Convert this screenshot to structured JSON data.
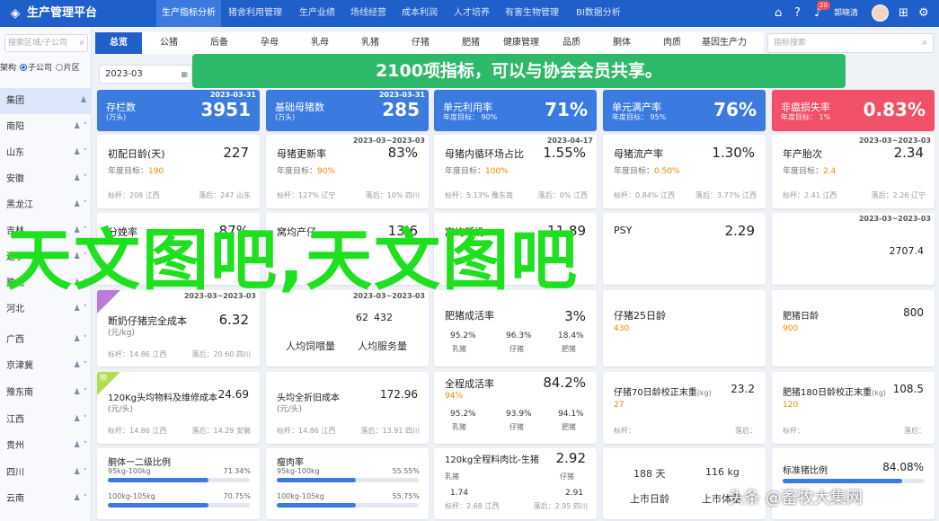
{
  "topbar": {
    "logo": "◈",
    "app_name": "生产管理平台",
    "nav": [
      "生产指标分析",
      "猪舍利用管理",
      "生产业绩",
      "场线经营",
      "成本利润",
      "人才培养",
      "有害生物管理",
      "BI数据分析"
    ],
    "active_index": 0,
    "notif_count": "20",
    "user": "郭晓清",
    "icons": [
      "home-icon",
      "help-icon",
      "bell-icon",
      "user-icon",
      "fullscreen-icon",
      "settings-icon"
    ]
  },
  "sidebar": {
    "search_placeholder": "搜索区域/子公司",
    "radio_label": "架构",
    "radio_opt1": "子公司",
    "radio_opt2": "片区",
    "items": [
      "集团",
      "南阳",
      "山东",
      "安徽",
      "黑龙江",
      "吉林",
      "辽宁",
      "豫北",
      "河北",
      "广西",
      "京津冀",
      "豫东南",
      "江西",
      "贵州",
      "四川",
      "云南"
    ]
  },
  "tabs": [
    "总览",
    "公猪",
    "后备",
    "孕母",
    "乳母",
    "乳猪",
    "仔猪",
    "肥猪",
    "健康管理",
    "品质",
    "胴体",
    "肉质",
    "基因生产力"
  ],
  "right_search_placeholder": "指标搜索",
  "date": "2023-03",
  "banner": "2100项指标，可以与协会会员共享。",
  "kpis": [
    {
      "title": "存栏数",
      "sub": "(万头)",
      "value": "3951",
      "date": "2023-03-31",
      "color": "#3b7be0"
    },
    {
      "title": "基础母猪数",
      "sub": "(万头)",
      "value": "285",
      "date": "2023-03-31",
      "color": "#3b7be0"
    },
    {
      "title": "单元利用率",
      "sub": "年度目标： 90%",
      "value": "71%",
      "date": "",
      "color": "#3b7be0"
    },
    {
      "title": "单元满产率",
      "sub": "年度目标： 95%",
      "value": "76%",
      "date": "",
      "color": "#3b7be0"
    },
    {
      "title": "非瘟损失率",
      "sub": "年度目标： 1%",
      "value": "0.83%",
      "date": "",
      "color": "#f05068"
    }
  ],
  "row1": [
    {
      "title": "初配日龄(天)",
      "value": "227",
      "date": "",
      "target_label": "年度目标：",
      "target": "190",
      "foot1": "标杆：208 江西",
      "foot2": "落后：247 山东"
    },
    {
      "title": "母猪更新率",
      "value": "83%",
      "date": "2023-03~2023-03",
      "target_label": "年度目标：",
      "target": "90%",
      "foot1": "标杆：127% 辽宁",
      "foot2": "落后：10% 四川"
    },
    {
      "title": "母猪内循环场占比",
      "value": "1.55%",
      "date": "2023-04-17",
      "target_label": "年度目标：",
      "target": "100%",
      "foot1": "标杆：5.13% 豫东南",
      "foot2": "落后：0% 江西"
    },
    {
      "title": "母猪流产率",
      "value": "1.30%",
      "date": "",
      "target_label": "年度目标：",
      "target": "0.50%",
      "foot1": "标杆：0.84% 江西",
      "foot2": "落后：3.77% 江西"
    },
    {
      "title": "年产胎次",
      "value": "2.34",
      "date": "2023-03~2023-03",
      "target_label": "年度目标：",
      "target": "2.4",
      "foot1": "标杆：2.41 江西",
      "foot2": "落后：2.26 辽宁"
    }
  ],
  "row2": [
    {
      "title": "分娩率",
      "value": "87%",
      "date": ""
    },
    {
      "title": "窝均产仔",
      "value": "13.6",
      "date": ""
    },
    {
      "title": "窝均断奶",
      "value": "11.89",
      "date": ""
    },
    {
      "title": "PSY",
      "value": "2.29",
      "date": "2023-03~2023-03"
    },
    {
      "title": "",
      "value": "2707.4",
      "date": ""
    }
  ],
  "row3": {
    "c1_title": "断奶仔猪完全成本",
    "c1_sub": "(元/kg)",
    "c1_value": "6.32",
    "c1_date": "2023-03~2023-03",
    "c1_foot1": "标杆：14.86 江西",
    "c1_foot2": "落后：20.60 四川",
    "c2_date": "2023-03~2023-03",
    "c2_l1": "人均饲喂量",
    "c2_l2": "人均服务量",
    "c2_v1": "62",
    "c2_v2": "432",
    "c3_title": "肥猪成活率",
    "c3_value": "3%",
    "c3_a": "95.2%",
    "c3_b": "96.3%",
    "c3_c": "18.4%",
    "c3_la": "乳猪",
    "c3_lb": "仔猪",
    "c3_lc": "肥猪",
    "c4_title": "仔猪25日龄",
    "c4_target": "430",
    "c4_value": "",
    "c5_title": "肥猪日龄",
    "c5_target": "900",
    "c5_value": "800"
  },
  "row4": {
    "c1_tag": "物",
    "c1_title": "120Kg头均物料及维修成本",
    "c1_sub": "(元/头)",
    "c1_value": "24.69",
    "c1_foot1": "标杆：14.86 江西",
    "c1_foot2": "落后：14.29 安徽",
    "c2_title": "头均全折旧成本",
    "c2_sub": "(元/头)",
    "c2_value": "172.96",
    "c2_foot1": "标杆：14.86 江西",
    "c2_foot2": "落后：13.91 四川",
    "c3_title": "全程成活率",
    "c3_value": "84.2%",
    "c3_target": "94%",
    "c3_a": "95.2%",
    "c3_b": "93.9%",
    "c3_c": "94.1%",
    "c3_la": "乳猪",
    "c3_lb": "仔猪",
    "c3_lc": "肥猪",
    "c4_title": "仔猪70日龄校正末重",
    "c4_sub": "(kg)",
    "c4_value": "23.2",
    "c4_target": "27",
    "c4_foot1": "标杆：",
    "c4_foot2": "落后：",
    "c5_title": "肥猪180日龄校正末重",
    "c5_sub": "(kg)",
    "c5_value": "108.5",
    "c5_target": "120",
    "c5_foot1": "标杆：",
    "c5_foot2": "落后："
  },
  "row5": {
    "c1_title": "胴体一二级比例",
    "c1_l1": "95kg-100kg",
    "c1_v1": "71.34%",
    "c1_l2": "100kg-105kg",
    "c1_v2": "70.75%",
    "c1_p1": 0.71,
    "c1_p2": 0.71,
    "c2_title": "瘦肉率",
    "c2_l1": "95kg-100kg",
    "c2_v1": "55.55%",
    "c2_l2": "100kg-105kg",
    "c2_v2": "55.75%",
    "c2_p1": 0.56,
    "c2_p2": 0.56,
    "c3_title": "120kg全程料肉比-生猪",
    "c3_value": "2.92",
    "c3_l1": "乳猪",
    "c3_l2": "仔猪",
    "c3_a": "1.74",
    "c3_b": "2.91",
    "c3_foot1": "标杆：2.68 江西",
    "c3_foot2": "落后：2.95 四川",
    "c4_a": "188 天",
    "c4_b": "116 kg",
    "c4_c": "上市日龄",
    "c4_d": "上市体重",
    "c5_title": "标准猪比例",
    "c5_value": "84.08%",
    "c5_p": 0.84
  },
  "watermark": "天文图吧,天文图吧",
  "footer_mark": "头条 @畜牧大集网"
}
